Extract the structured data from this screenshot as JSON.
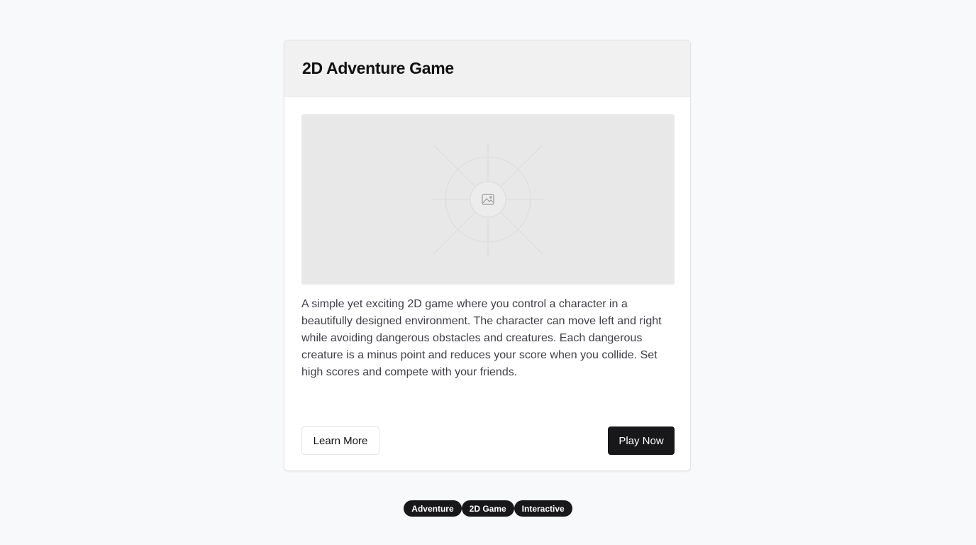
{
  "card": {
    "title": "2D Adventure Game",
    "image_icon": "image-icon",
    "description": "A simple yet exciting 2D game where you control a character in a beautifully designed environment. The character can move left and right while avoiding dangerous obstacles and creatures. Each dangerous creature is a minus point and reduces your score when you collide. Set high scores and compete with your friends.",
    "secondary_button": "Learn More",
    "primary_button": "Play Now"
  },
  "tags": [
    "Adventure",
    "2D Game",
    "Interactive"
  ],
  "colors": {
    "page_background": "#f8f9fa",
    "header_background": "#f1f1f1",
    "primary": "#18181b",
    "text": "#3f3f46"
  }
}
